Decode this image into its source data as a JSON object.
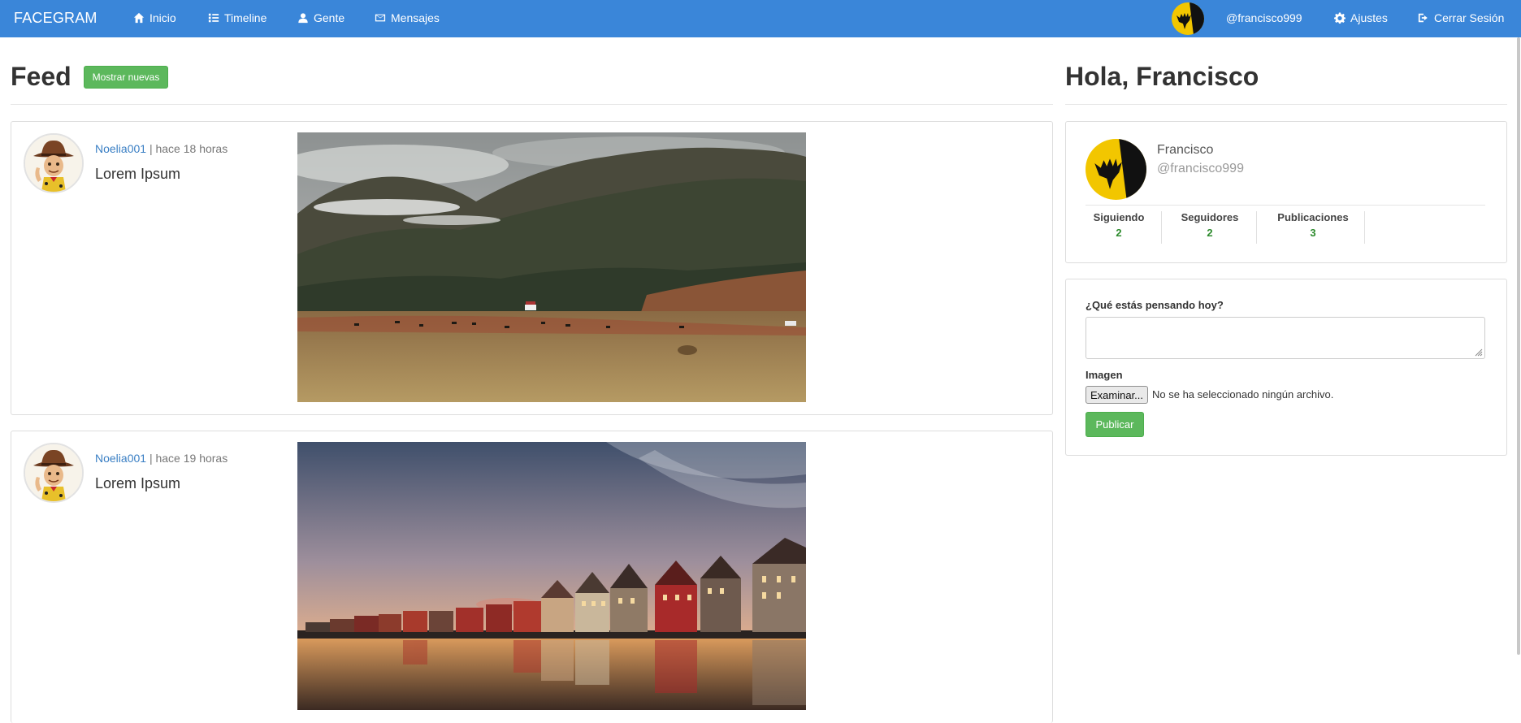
{
  "navbar": {
    "brand": "FACEGRAM",
    "links": [
      {
        "label": "Inicio",
        "icon": "home-icon"
      },
      {
        "label": "Timeline",
        "icon": "list-icon"
      },
      {
        "label": "Gente",
        "icon": "user-icon"
      },
      {
        "label": "Mensajes",
        "icon": "envelope-icon"
      }
    ],
    "user_handle": "@francisco999",
    "settings_label": "Ajustes",
    "logout_label": "Cerrar Sesión",
    "color": "#3a86d9"
  },
  "feed": {
    "title": "Feed",
    "show_new_label": "Mostrar nuevas",
    "posts": [
      {
        "author": "Noelia001",
        "separator": "|",
        "time": "hace 18 horas",
        "text": "Lorem Ipsum",
        "image": "mountain-landscape"
      },
      {
        "author": "Noelia001",
        "separator": "|",
        "time": "hace 19 horas",
        "text": "Lorem Ipsum",
        "image": "waterfront-houses-sunset"
      }
    ]
  },
  "sidebar": {
    "greeting": "Hola, Francisco",
    "profile": {
      "name": "Francisco",
      "handle": "@francisco999",
      "stats": [
        {
          "label": "Siguiendo",
          "value": "2"
        },
        {
          "label": "Seguidores",
          "value": "2"
        },
        {
          "label": "Publicaciones",
          "value": "3"
        }
      ]
    },
    "compose": {
      "prompt_label": "¿Qué estás pensando hoy?",
      "text_value": "",
      "image_label": "Imagen",
      "browse_label": "Examinar...",
      "file_status": "No se ha seleccionado ningún archivo.",
      "publish_label": "Publicar"
    }
  },
  "colors": {
    "success": "#5cb85c",
    "link": "#3a7fc4",
    "stat_number": "#2e8b2e"
  }
}
